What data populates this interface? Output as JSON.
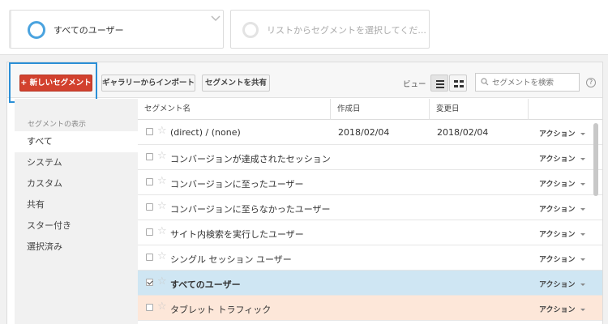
{
  "segment_bar": {
    "selected_segment": "すべてのユーザー",
    "placeholder_segment": "リストからセグメントを選択してくだ..."
  },
  "toolbar": {
    "new_segment_label": "+ 新しいセグメント",
    "import_label": "ギャラリーからインポート",
    "share_label": "セグメントを共有",
    "view_label": "ビュー",
    "search_placeholder": "セグメントを検索",
    "help_label": "?"
  },
  "sidebar": {
    "heading": "セグメントの表示",
    "items": [
      {
        "label": "すべて",
        "active": true
      },
      {
        "label": "システム"
      },
      {
        "label": "カスタム"
      },
      {
        "label": "共有"
      },
      {
        "label": "スター付き"
      },
      {
        "label": "選択済み"
      }
    ]
  },
  "table": {
    "columns": [
      "セグメント名",
      "作成日",
      "変更日"
    ],
    "action_label": "アクション",
    "rows": [
      {
        "name": "(direct) / (none)",
        "created": "2018/02/04",
        "modified": "2018/02/04",
        "checked": false
      },
      {
        "name": "コンバージョンが達成されたセッション",
        "created": "",
        "modified": "",
        "checked": false
      },
      {
        "name": "コンバージョンに至ったユーザー",
        "created": "",
        "modified": "",
        "checked": false
      },
      {
        "name": "コンバージョンに至らなかったユーザー",
        "created": "",
        "modified": "",
        "checked": false
      },
      {
        "name": "サイト内検索を実行したユーザー",
        "created": "",
        "modified": "",
        "checked": false
      },
      {
        "name": "シングル セッション ユーザー",
        "created": "",
        "modified": "",
        "checked": false
      },
      {
        "name": "すべてのユーザー",
        "created": "",
        "modified": "",
        "checked": true
      },
      {
        "name": "タブレット トラフィック",
        "created": "",
        "modified": "",
        "checked": false
      }
    ]
  },
  "colors": {
    "accent_red": "#d2412e",
    "highlight_blue": "#2b8fd6",
    "selected_row": "#cfe6f3",
    "hover_row": "#fde7d9"
  }
}
